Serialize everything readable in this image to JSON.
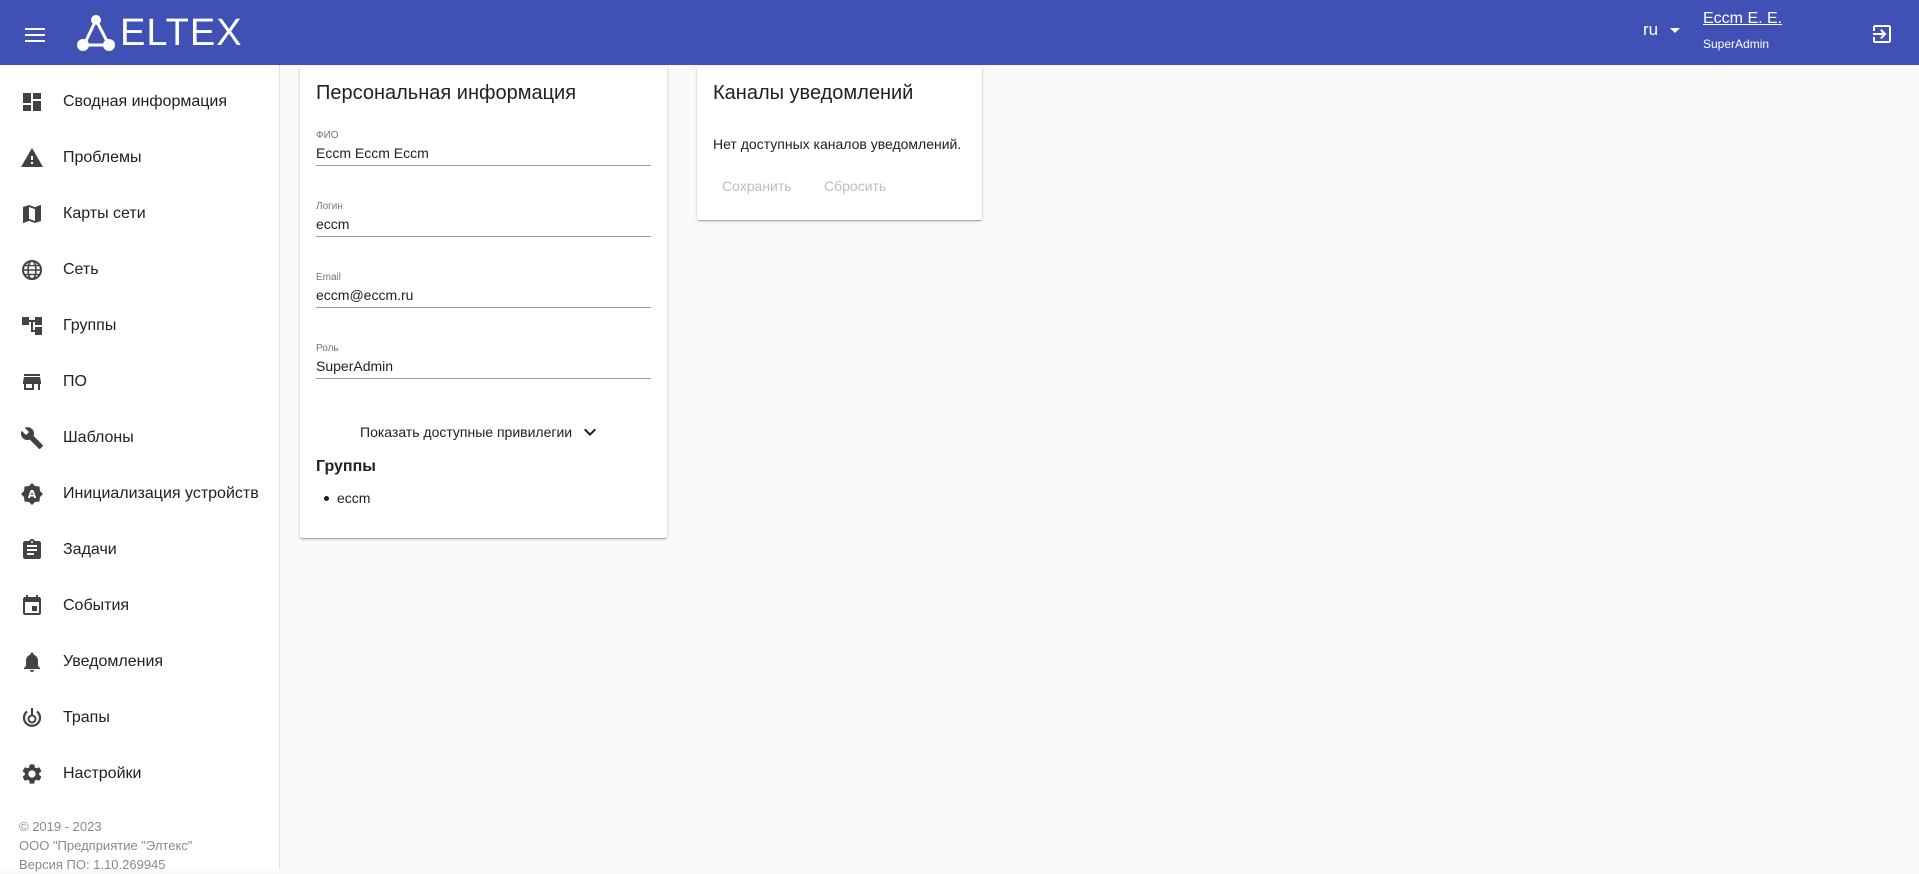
{
  "header": {
    "logo": "ELTEX",
    "language": "ru",
    "user_name": "Eccm E. E.",
    "user_role": "SuperAdmin",
    "bar_color": "#3f51b5"
  },
  "sidebar": {
    "items": [
      {
        "label": "Сводная информация",
        "icon": "dashboard-icon"
      },
      {
        "label": "Проблемы",
        "icon": "warning-icon"
      },
      {
        "label": "Карты сети",
        "icon": "map-icon"
      },
      {
        "label": "Сеть",
        "icon": "globe-icon"
      },
      {
        "label": "Группы",
        "icon": "hierarchy-icon"
      },
      {
        "label": "ПО",
        "icon": "store-icon"
      },
      {
        "label": "Шаблоны",
        "icon": "wrench-icon"
      },
      {
        "label": "Инициализация устройств",
        "icon": "auto-setup-icon"
      },
      {
        "label": "Задачи",
        "icon": "clipboard-icon"
      },
      {
        "label": "События",
        "icon": "calendar-icon"
      },
      {
        "label": "Уведомления",
        "icon": "bell-icon"
      },
      {
        "label": "Трапы",
        "icon": "trap-icon"
      },
      {
        "label": "Настройки",
        "icon": "gear-icon"
      }
    ],
    "footer": {
      "copyright": "© 2019 - 2023",
      "company": "ООО \"Предприятие \"Элтекс\"",
      "version": "Версия ПО: 1.10.269945"
    }
  },
  "personal": {
    "title": "Персональная информация",
    "fields": [
      {
        "label": "ФИО",
        "value": "Eccm Eccm Eccm"
      },
      {
        "label": "Логин",
        "value": "eccm"
      },
      {
        "label": "Email",
        "value": "eccm@eccm.ru"
      },
      {
        "label": "Роль",
        "value": "SuperAdmin"
      }
    ],
    "show_privileges": "Показать доступные привилегии",
    "groups_title": "Группы",
    "groups": [
      "eccm"
    ]
  },
  "channels": {
    "title": "Каналы уведомлений",
    "empty_text": "Нет доступных каналов уведомлений.",
    "save_label": "Сохранить",
    "reset_label": "Сбросить"
  }
}
